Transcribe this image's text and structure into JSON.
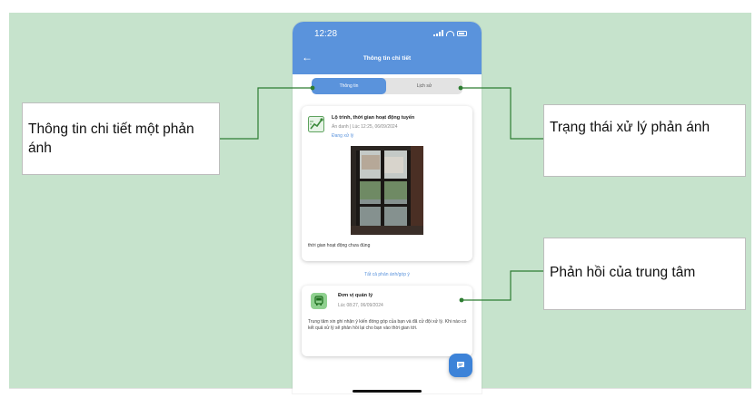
{
  "phone": {
    "status_time": "12:28",
    "screen_title": "Thông tin chi tiết",
    "tabs": [
      {
        "label": "Thông tin",
        "active": true
      },
      {
        "label": "Lịch sử",
        "active": false
      }
    ],
    "report": {
      "category": "Lộ trình, thời gian hoạt động tuyến",
      "meta": "Ẩn danh | Lúc 12:25, 06/09/2024",
      "status": "Đang xử lý",
      "description": "thời gian hoạt động chưa đúng"
    },
    "all_reports_link": "Tất cả phản ánh/góp ý",
    "reply": {
      "title": "Đơn vị quản lý",
      "time": "Lúc 08:27, 06/09/2024",
      "body": "Trung tâm xin ghi nhận ý kiến đóng góp của bạn và đã cử đội xử lý. Khi nào có kết quả xử lý sẽ phản hồi lại cho bạn vào thời gian tới."
    }
  },
  "callouts": {
    "left": "Thông tin chi tiết một phản ánh",
    "right_top": "Trạng thái xử lý phản ánh",
    "right_bottom": "Phản hồi của trung tâm"
  },
  "colors": {
    "slide_bg": "#c6e3cc",
    "primary": "#5a93dc",
    "connector": "#2e7d32"
  },
  "icons": [
    "back-arrow-icon",
    "signal-icon",
    "wifi-icon",
    "battery-icon",
    "route-map-icon",
    "bus-icon",
    "chat-icon"
  ]
}
